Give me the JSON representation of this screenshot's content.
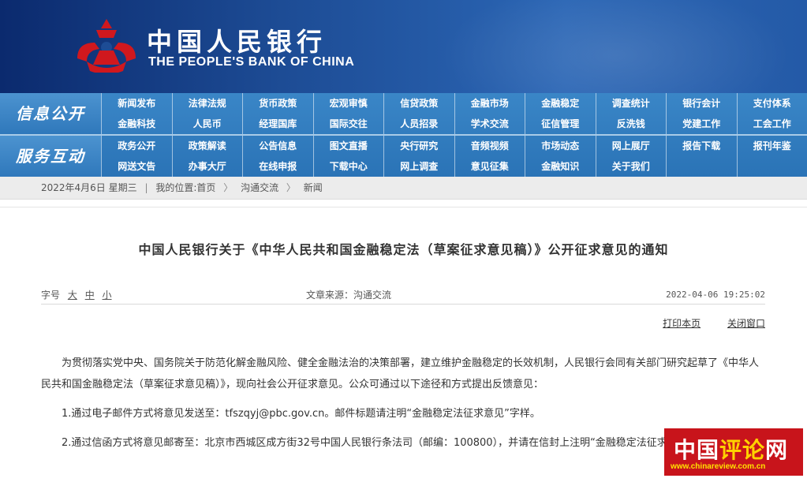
{
  "header": {
    "logo_cn": "中国人民银行",
    "logo_en": "THE PEOPLE'S BANK OF CHINA",
    "logo_icon": "pboc-emblem-icon",
    "colors": {
      "brand_red": "#d0181e",
      "header_blue": "#1d4c95"
    }
  },
  "nav": {
    "section1": {
      "title": "信息公开",
      "row1": [
        "新闻发布",
        "法律法规",
        "货币政策",
        "宏观审慎",
        "信贷政策",
        "金融市场",
        "金融稳定",
        "调查统计",
        "银行会计",
        "支付体系"
      ],
      "row2": [
        "金融科技",
        "人民币",
        "经理国库",
        "国际交往",
        "人员招录",
        "学术交流",
        "征信管理",
        "反洗钱",
        "党建工作",
        "工会工作"
      ]
    },
    "section2": {
      "title": "服务互动",
      "row1": [
        "政务公开",
        "政策解读",
        "公告信息",
        "图文直播",
        "央行研究",
        "音频视频",
        "市场动态",
        "网上展厅",
        "报告下载",
        "报刊年鉴"
      ],
      "row2": [
        "网送文告",
        "办事大厅",
        "在线申报",
        "下载中心",
        "网上调查",
        "意见征集",
        "金融知识",
        "关于我们",
        "",
        ""
      ]
    }
  },
  "breadcrumb": {
    "date": "2022年4月6日 星期三",
    "divider": "|",
    "location_label": "我的位置:",
    "items": [
      "首页",
      "沟通交流",
      "新闻"
    ],
    "sep": "〉"
  },
  "article": {
    "title": "中国人民银行关于《中华人民共和国金融稳定法（草案征求意见稿）》公开征求意见的通知",
    "font_size_label": "字号",
    "font_sizes": [
      "大",
      "中",
      "小"
    ],
    "source": "文章来源：沟通交流",
    "datetime": "2022-04-06 19:25:02",
    "print_label": "打印本页",
    "close_label": "关闭窗口",
    "paragraphs": [
      "为贯彻落实党中央、国务院关于防范化解金融风险、健全金融法治的决策部署，建立维护金融稳定的长效机制，人民银行会同有关部门研究起草了《中华人民共和国金融稳定法（草案征求意见稿）》，现向社会公开征求意见。公众可通过以下途径和方式提出反馈意见：",
      "1.通过电子邮件方式将意见发送至：tfszqyj@pbc.gov.cn。邮件标题请注明“金融稳定法征求意见”字样。",
      "2.通过信函方式将意见邮寄至：北京市西城区成方街32号中国人民银行条法司（邮编：100800），并请在信封上注明“金融稳定法征求意见”字样。"
    ]
  },
  "watermark": {
    "text_a": "中国",
    "text_b": "评论",
    "text_c": "网",
    "url": "www.chinareview.com.cn"
  }
}
